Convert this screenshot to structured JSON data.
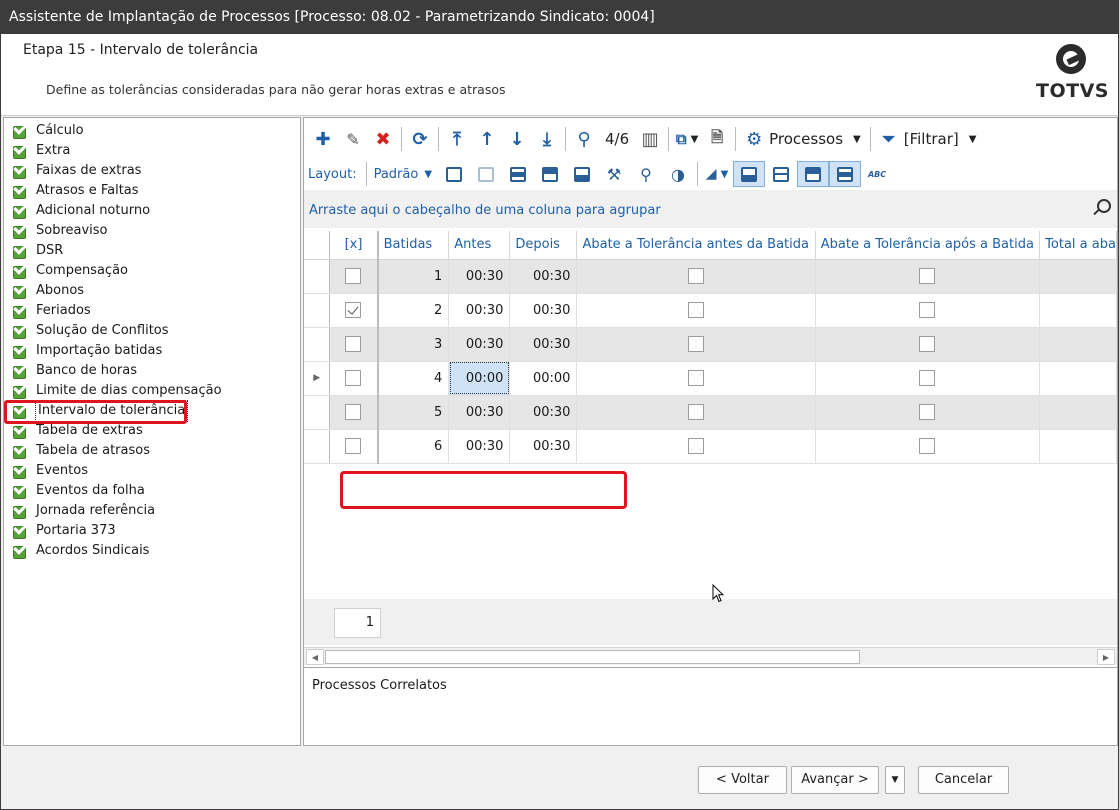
{
  "window": {
    "title": "Assistente de Implantação de Processos [Processo: 08.02 - Parametrizando Sindicato: 0004]"
  },
  "header": {
    "step": "Etapa 15 - Intervalo de tolerância",
    "description": "Define as tolerâncias consideradas para não gerar horas extras e atrasos",
    "logo_text": "TOTVS"
  },
  "sidebar": {
    "items": [
      {
        "label": "Cálculo"
      },
      {
        "label": "Extra"
      },
      {
        "label": "Faixas de extras"
      },
      {
        "label": "Atrasos e Faltas"
      },
      {
        "label": "Adicional noturno"
      },
      {
        "label": "Sobreaviso"
      },
      {
        "label": "DSR"
      },
      {
        "label": "Compensação"
      },
      {
        "label": "Abonos"
      },
      {
        "label": "Feriados"
      },
      {
        "label": "Solução de Conflitos"
      },
      {
        "label": "Importação batidas"
      },
      {
        "label": "Banco de horas"
      },
      {
        "label": "Limite de dias compensação"
      },
      {
        "label": "Intervalo de tolerância"
      },
      {
        "label": "Tabela de extras"
      },
      {
        "label": "Tabela de atrasos"
      },
      {
        "label": "Eventos"
      },
      {
        "label": "Eventos da folha"
      },
      {
        "label": "Jornada referência"
      },
      {
        "label": "Portaria 373"
      },
      {
        "label": "Acordos Sindicais"
      }
    ],
    "selected_index": 14
  },
  "toolbar": {
    "record_position": "4/6",
    "processos_label": "Processos",
    "filtrar_label": "[Filtrar]",
    "icons": [
      "plus-icon",
      "pencil-icon",
      "delete-x-icon",
      "refresh-icon",
      "arrow-top-icon",
      "arrow-up-icon",
      "arrow-down-icon",
      "arrow-bottom-icon",
      "search-icon",
      "columns-icon",
      "export-icon",
      "document-icon",
      "gear-icon",
      "filter-icon"
    ]
  },
  "layout_bar": {
    "label": "Layout:",
    "preset": "Padrão",
    "abc_label": "ABC"
  },
  "group_bar": {
    "text": "Arraste aqui o cabeçalho de uma coluna para agrupar"
  },
  "grid": {
    "columns": [
      "[x]",
      "Batidas",
      "Antes",
      "Depois",
      "Abate a Tolerância antes da Batida",
      "Abate a Tolerância após a Batida",
      "Total a aba"
    ],
    "rows": [
      {
        "checked": false,
        "batidas": "1",
        "antes": "00:30",
        "depois": "00:30",
        "abate_antes": false,
        "abate_apos": false
      },
      {
        "checked": true,
        "batidas": "2",
        "antes": "00:30",
        "depois": "00:30",
        "abate_antes": false,
        "abate_apos": false
      },
      {
        "checked": false,
        "batidas": "3",
        "antes": "00:30",
        "depois": "00:30",
        "abate_antes": false,
        "abate_apos": false
      },
      {
        "checked": false,
        "batidas": "4",
        "antes": "00:00",
        "depois": "00:00",
        "abate_antes": false,
        "abate_apos": false
      },
      {
        "checked": false,
        "batidas": "5",
        "antes": "00:30",
        "depois": "00:30",
        "abate_antes": false,
        "abate_apos": false
      },
      {
        "checked": false,
        "batidas": "6",
        "antes": "00:30",
        "depois": "00:30",
        "abate_antes": false,
        "abate_apos": false
      }
    ],
    "current_row": 3,
    "footer_count": "1"
  },
  "related": {
    "label": "Processos Correlatos"
  },
  "buttons": {
    "back_label": "< Voltar",
    "next_label": "Avançar >",
    "cancel_label": "Cancelar"
  },
  "colors": {
    "accent": "#1f5fa8",
    "highlight": "#e0141e",
    "titlebar": "#3c3c3c",
    "selection": "#cfe2f6"
  }
}
